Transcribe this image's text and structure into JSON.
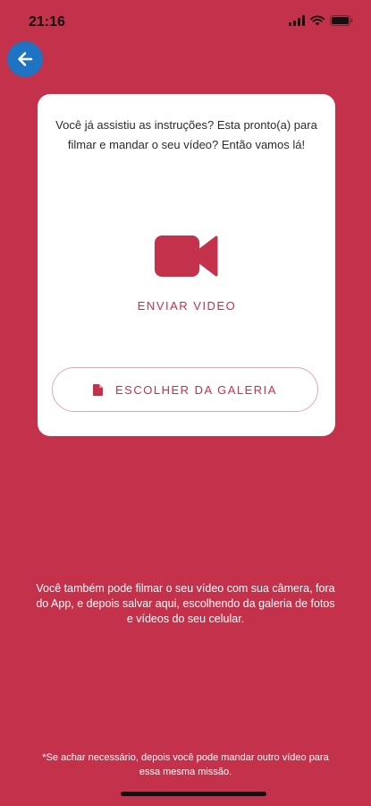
{
  "status_bar": {
    "time": "21:16",
    "icons": [
      "cellular-signal-icon",
      "wifi-icon",
      "battery-icon"
    ]
  },
  "back_button": {
    "icon": "arrow-left-icon",
    "color": "#1e73c2"
  },
  "card": {
    "intro_text": "Você já assistiu as instruções? Esta pronto(a) para filmar e mandar o seu vídeo? Então vamos lá!",
    "record": {
      "icon": "video-camera-icon",
      "label": "ENVIAR VIDEO"
    },
    "gallery": {
      "icon": "file-icon",
      "label": "ESCOLHER DA GALERIA"
    }
  },
  "note": "Você também pode filmar o seu vídeo com sua câmera, fora do App, e depois salvar aqui, escolhendo da galeria de fotos e vídeos do seu celular.",
  "footnote": "*Se achar necessário, depois você pode mandar outro vídeo para essa mesma missão.",
  "colors": {
    "background": "#c3324a",
    "accent": "#c3324a",
    "card": "#ffffff"
  }
}
